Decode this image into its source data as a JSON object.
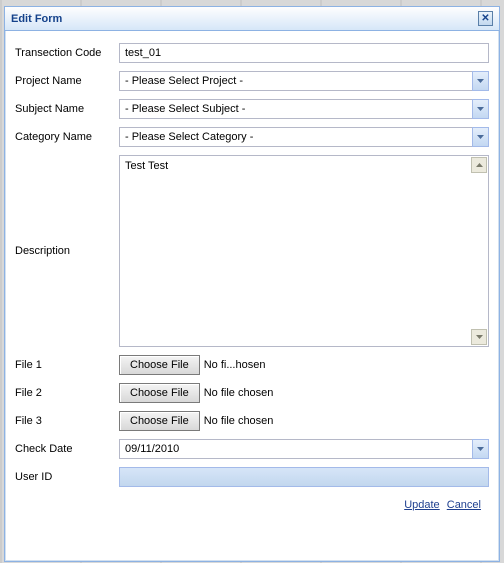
{
  "window": {
    "title": "Edit Form"
  },
  "labels": {
    "transaction_code": "Transection Code",
    "project_name": "Project Name",
    "subject_name": "Subject Name",
    "category_name": "Category Name",
    "description": "Description",
    "file1": "File 1",
    "file2": "File 2",
    "file3": "File 3",
    "check_date": "Check Date",
    "user_id": "User ID"
  },
  "values": {
    "transaction_code": "test_01",
    "project_name": "- Please Select Project -",
    "subject_name": "- Please Select Subject -",
    "category_name": "- Please Select Category -",
    "description": "Test Test",
    "check_date": "09/11/2010",
    "user_id": ""
  },
  "file": {
    "choose_label": "Choose File",
    "status1": "No fi...hosen",
    "status2": "No file chosen",
    "status3": "No file chosen"
  },
  "actions": {
    "update": "Update",
    "cancel": "Cancel"
  }
}
